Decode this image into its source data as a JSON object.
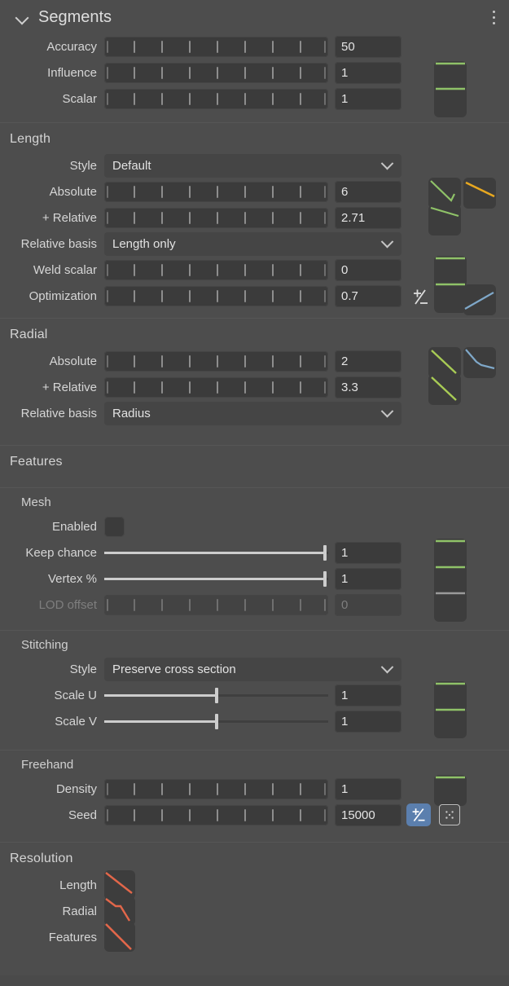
{
  "header": {
    "title": "Segments",
    "collapse_icon": "chevron-down-icon",
    "menu_icon": "kebab-menu-icon"
  },
  "segments": {
    "rows": [
      {
        "label": "Accuracy",
        "value": "50",
        "slider": "ticked"
      },
      {
        "label": "Influence",
        "value": "1",
        "slider": "ticked"
      },
      {
        "label": "Scalar",
        "value": "1",
        "slider": "ticked"
      }
    ]
  },
  "length": {
    "title": "Length",
    "style_label": "Style",
    "style_value": "Default",
    "rows": [
      {
        "label": "Absolute",
        "value": "6"
      },
      {
        "label": "+ Relative",
        "value": "2.71"
      }
    ],
    "relative_basis_label": "Relative basis",
    "relative_basis_value": "Length only",
    "rows2": [
      {
        "label": "Weld scalar",
        "value": "0"
      },
      {
        "label": "Optimization",
        "value": "0.7"
      }
    ]
  },
  "radial": {
    "title": "Radial",
    "rows": [
      {
        "label": "Absolute",
        "value": "2"
      },
      {
        "label": "+ Relative",
        "value": "3.3"
      }
    ],
    "relative_basis_label": "Relative basis",
    "relative_basis_value": "Radius"
  },
  "features": {
    "title": "Features",
    "mesh": {
      "title": "Mesh",
      "enabled_label": "Enabled",
      "rows": [
        {
          "label": "Keep chance",
          "value": "1"
        },
        {
          "label": "Vertex %",
          "value": "1"
        },
        {
          "label": "LOD offset",
          "value": "0"
        }
      ]
    },
    "stitching": {
      "title": "Stitching",
      "style_label": "Style",
      "style_value": "Preserve cross section",
      "rows": [
        {
          "label": "Scale U",
          "value": "1"
        },
        {
          "label": "Scale V",
          "value": "1"
        }
      ]
    },
    "freehand": {
      "title": "Freehand",
      "rows": [
        {
          "label": "Density",
          "value": "1"
        },
        {
          "label": "Seed",
          "value": "15000"
        }
      ],
      "plusminus_icon": "plus-minus-icon",
      "dice_icon": "dice-randomize-icon"
    }
  },
  "resolution": {
    "title": "Resolution",
    "rows": [
      {
        "label": "Length"
      },
      {
        "label": "Radial"
      },
      {
        "label": "Features"
      }
    ]
  },
  "colors": {
    "panel_bg": "#4d4d4d",
    "field_bg": "#3b3b3b",
    "accent_green": "#8fc268",
    "accent_orange": "#e8a820",
    "accent_blue": "#7fa8c9",
    "accent_red": "#e2674a",
    "button_blue": "#5b7fae",
    "text": "#d9d9d9"
  }
}
